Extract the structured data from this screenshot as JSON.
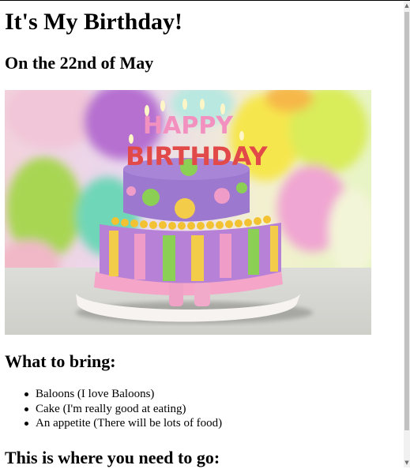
{
  "page": {
    "title": "It's My Birthday!",
    "subtitle": "On the 22nd of May",
    "bring_heading": "What to bring:",
    "bring_items": [
      "Baloons (I love Baloons)",
      "Cake (I'm really good at eating)",
      "An appetite (There will be lots of food)"
    ],
    "go_heading": "This is where you need to go:"
  },
  "photo": {
    "candles_text": [
      "HAPPY",
      "BIRTHDAY"
    ]
  },
  "scrollbar": {
    "up_icon": "arrow-up-icon",
    "down_icon": "arrow-down-icon"
  }
}
